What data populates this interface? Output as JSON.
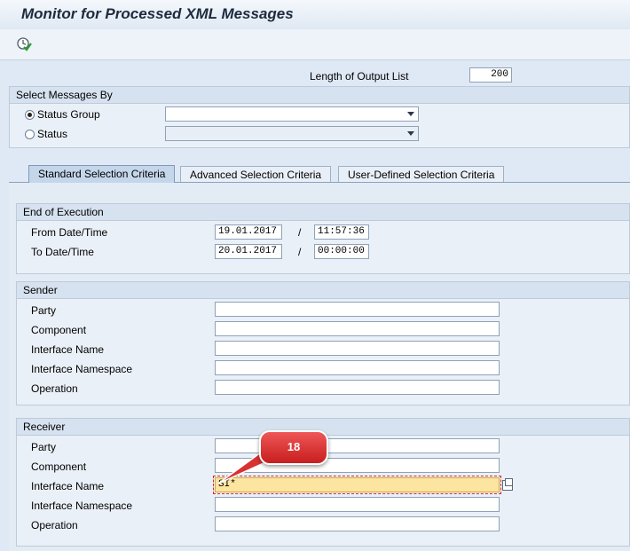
{
  "window": {
    "title": "Monitor for Processed XML Messages"
  },
  "toolbar": {
    "execute_icon": "execute-icon"
  },
  "output_list": {
    "label": "Length of Output List",
    "value": "200"
  },
  "select_by": {
    "header": "Select Messages By",
    "status_group_label": "Status Group",
    "status_group_value": "",
    "status_label": "Status",
    "status_value": "",
    "selected": "Status Group"
  },
  "tabs": [
    {
      "label": "Standard Selection Criteria",
      "active": true
    },
    {
      "label": "Advanced Selection Criteria",
      "active": false
    },
    {
      "label": "User-Defined Selection Criteria",
      "active": false
    }
  ],
  "end_of_execution": {
    "header": "End of Execution",
    "from_label": "From Date/Time",
    "from_date": "19.01.2017",
    "from_time": "11:57:36",
    "to_label": "To Date/Time",
    "to_date": "20.01.2017",
    "to_time": "00:00:00",
    "separator": "/"
  },
  "sender": {
    "header": "Sender",
    "fields": [
      {
        "label": "Party",
        "value": ""
      },
      {
        "label": "Component",
        "value": ""
      },
      {
        "label": "Interface Name",
        "value": ""
      },
      {
        "label": "Interface Namespace",
        "value": ""
      },
      {
        "label": "Operation",
        "value": ""
      }
    ]
  },
  "receiver": {
    "header": "Receiver",
    "fields": [
      {
        "label": "Party",
        "value": ""
      },
      {
        "label": "Component",
        "value": ""
      },
      {
        "label": "Interface Name",
        "value": "SI*"
      },
      {
        "label": "Interface Namespace",
        "value": ""
      },
      {
        "label": "Operation",
        "value": ""
      }
    ]
  },
  "callout": {
    "text": "18"
  },
  "colors": {
    "callout": "#d93030",
    "highlight": "#fbe5a0"
  }
}
